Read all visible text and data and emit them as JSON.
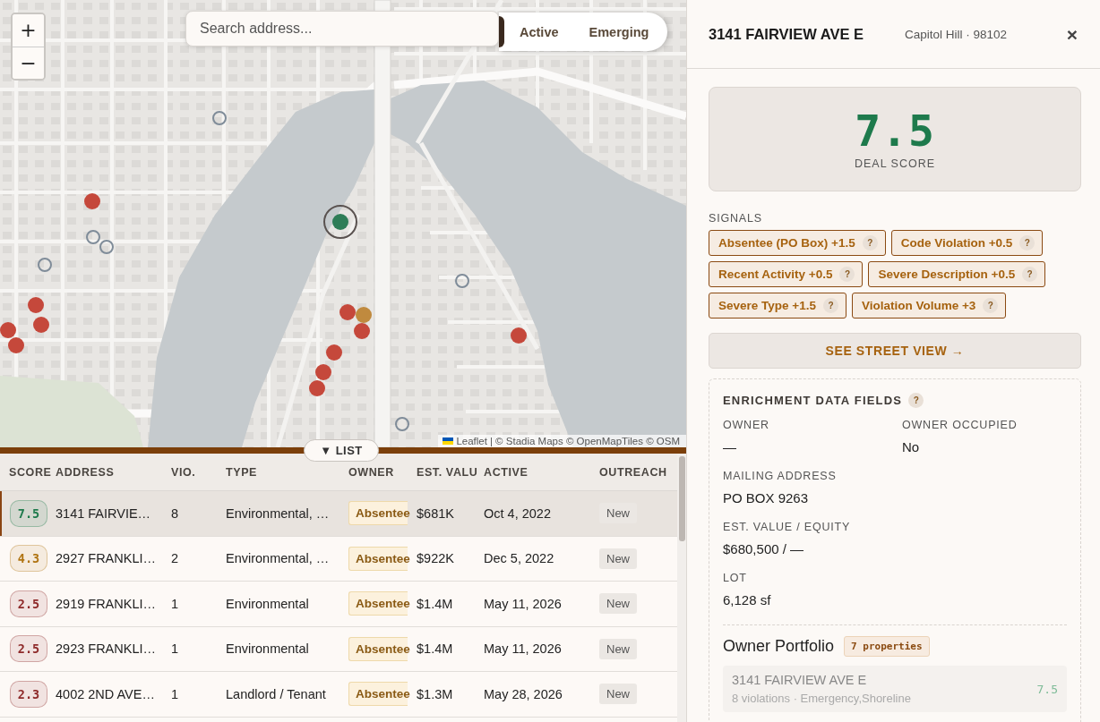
{
  "map": {
    "zoom_controls": [
      "+",
      "−"
    ],
    "search": {
      "placeholder": "Search address..."
    },
    "tabs": [
      {
        "selected": true
      },
      {
        "label": "Active",
        "selected": false
      },
      {
        "label": "Emerging",
        "selected": false
      }
    ],
    "markers": [
      {
        "kind": "dot",
        "color": "#c5483b",
        "selected": false
      },
      {
        "kind": "dot",
        "color": "#c5483b",
        "selected": false
      },
      {
        "kind": "dot",
        "color": "#c5483b",
        "selected": false
      },
      {
        "kind": "dot",
        "color": "#c5483b",
        "selected": false
      },
      {
        "kind": "dot",
        "color": "#c5483b",
        "selected": false
      },
      {
        "kind": "dot",
        "color": "#c08a3e",
        "selected": false
      },
      {
        "kind": "dot",
        "color": "#c5483b",
        "selected": false
      },
      {
        "kind": "dot",
        "color": "#c5483b",
        "selected": false
      },
      {
        "kind": "dot",
        "color": "#c5483b",
        "selected": false
      },
      {
        "kind": "dot",
        "color": "#c5483b",
        "selected": false
      },
      {
        "kind": "dot",
        "color": "#c5483b",
        "selected": false
      },
      {
        "kind": "dot",
        "color": "#c5483b",
        "selected": false
      },
      {
        "kind": "ring",
        "color": "#7f8c99",
        "selected": false
      },
      {
        "kind": "ring",
        "color": "#7f8c99",
        "selected": false
      },
      {
        "kind": "ring",
        "color": "#7f8c99",
        "selected": false
      },
      {
        "kind": "ring",
        "color": "#7f8c99",
        "selected": false
      },
      {
        "kind": "ring",
        "color": "#7f8c99",
        "selected": false
      },
      {
        "kind": "ring",
        "color": "#7f8c99",
        "selected": false
      },
      {
        "kind": "dot",
        "color": "#2e7d57",
        "selected": true
      }
    ],
    "attribution": {
      "link": "Leaflet",
      "credits": "| © Stadia Maps © OpenMapTiles © OSM"
    }
  },
  "list_toggle": "▼ LIST",
  "table": {
    "columns": [
      "SCORE",
      "ADDRESS",
      "VIO.",
      "TYPE",
      "OWNER",
      "EST. VALU",
      "ACTIVE",
      "OUTREACH"
    ],
    "rows": [
      {
        "score": "7.5",
        "color": "#1e7a4c",
        "selected": true,
        "address": "3141 FAIRVIE…",
        "violations": "8",
        "type": "Environmental, …",
        "owner": "Absentee",
        "est_value": "$681K",
        "active": "Oct 4, 2022",
        "outreach": "New"
      },
      {
        "score": "4.3",
        "color": "#b07412",
        "selected": false,
        "address": "2927 FRANKLI…",
        "violations": "2",
        "type": "Environmental, …",
        "owner": "Absentee",
        "est_value": "$922K",
        "active": "Dec 5, 2022",
        "outreach": "New"
      },
      {
        "score": "2.5",
        "color": "#8e2a2a",
        "selected": false,
        "address": "2919 FRANKLI…",
        "violations": "1",
        "type": "Environmental",
        "owner": "Absentee",
        "est_value": "$1.4M",
        "active": "May 11, 2026",
        "outreach": "New"
      },
      {
        "score": "2.5",
        "color": "#8e2a2a",
        "selected": false,
        "address": "2923 FRANKLI…",
        "violations": "1",
        "type": "Environmental",
        "owner": "Absentee",
        "est_value": "$1.4M",
        "active": "May 11, 2026",
        "outreach": "New"
      },
      {
        "score": "2.3",
        "color": "#8e2a2a",
        "selected": false,
        "address": "4002 2ND AVE…",
        "violations": "1",
        "type": "Landlord / Tenant",
        "owner": "Absentee",
        "est_value": "$1.3M",
        "active": "May 28, 2026",
        "outreach": "New"
      }
    ]
  },
  "detail": {
    "title": "3141 FAIRVIEW AVE E",
    "subtitle": "Capitol Hill · 98102",
    "close": "×",
    "deal_score": {
      "value": "7.5",
      "label": "DEAL SCORE"
    },
    "signals": {
      "label": "SIGNALS",
      "items": [
        {
          "label": "Absentee (PO Box) +1.5",
          "help": "?"
        },
        {
          "label": "Code Violation +0.5",
          "help": "?"
        },
        {
          "label": "Recent Activity +0.5",
          "help": "?"
        },
        {
          "label": "Severe Description +0.5",
          "help": "?"
        },
        {
          "label": "Severe Type +1.5",
          "help": "?"
        },
        {
          "label": "Violation Volume +3",
          "help": "?"
        }
      ]
    },
    "street_view": "SEE STREET VIEW →",
    "enrichment": {
      "title": "ENRICHMENT DATA FIELDS",
      "help": "?",
      "fields": [
        {
          "label": "OWNER",
          "value": "—"
        },
        {
          "label": "OWNER OCCUPIED",
          "value": "No"
        },
        {
          "label": "MAILING ADDRESS",
          "value": "PO BOX 9263"
        },
        {
          "label": "EST. VALUE / EQUITY",
          "value": "$680,500 / —"
        },
        {
          "label": "LOT",
          "value": "6,128 sf"
        }
      ]
    },
    "portfolio": {
      "title": "Owner Portfolio",
      "count": "7 properties",
      "items": [
        {
          "address": "3141 FAIRVIEW AVE E",
          "detail": "8 violations · Emergency,Shoreline",
          "score": "7.5"
        }
      ]
    }
  }
}
